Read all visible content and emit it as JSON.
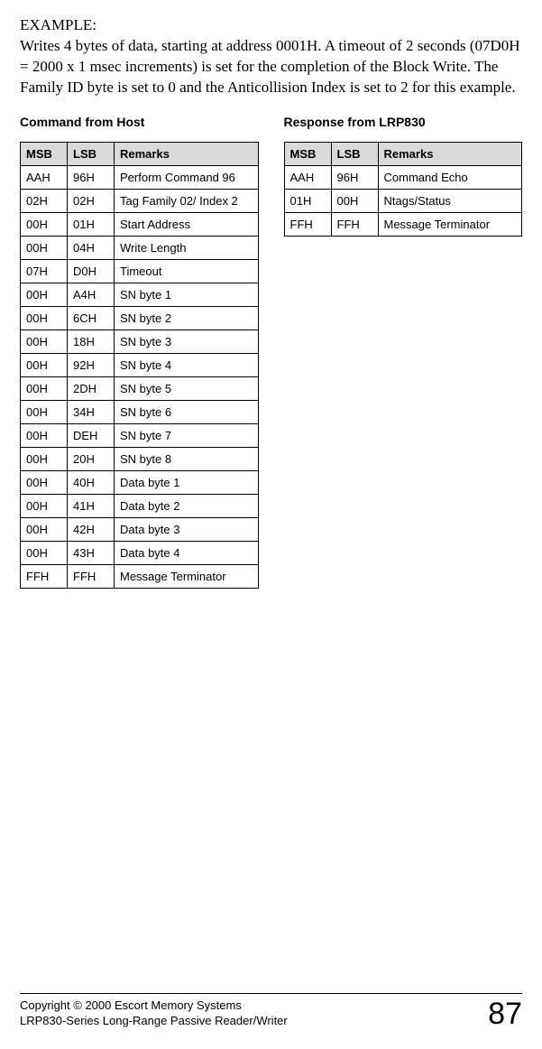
{
  "example": {
    "label": "EXAMPLE:",
    "paragraph": "Writes 4 bytes of data, starting at address 0001H. A timeout of 2 seconds (07D0H = 2000 x 1 msec increments) is set for the completion of the Block Write.  The Family ID byte is set to 0 and the Anticollision Index is set to 2 for this example."
  },
  "left": {
    "title": "Command from Host",
    "headers": {
      "msb": "MSB",
      "lsb": "LSB",
      "remarks": "Remarks"
    },
    "rows": [
      {
        "msb": "AAH",
        "lsb": "96H",
        "remarks": "Perform Command 96"
      },
      {
        "msb": "02H",
        "lsb": "02H",
        "remarks": "Tag Family 02/ Index 2"
      },
      {
        "msb": "00H",
        "lsb": "01H",
        "remarks": "Start Address"
      },
      {
        "msb": "00H",
        "lsb": "04H",
        "remarks": "Write Length"
      },
      {
        "msb": "07H",
        "lsb": "D0H",
        "remarks": "Timeout"
      },
      {
        "msb": "00H",
        "lsb": "A4H",
        "remarks": "SN byte 1"
      },
      {
        "msb": "00H",
        "lsb": "6CH",
        "remarks": "SN byte 2"
      },
      {
        "msb": "00H",
        "lsb": "18H",
        "remarks": "SN byte 3"
      },
      {
        "msb": "00H",
        "lsb": "92H",
        "remarks": "SN byte 4"
      },
      {
        "msb": "00H",
        "lsb": "2DH",
        "remarks": "SN byte 5"
      },
      {
        "msb": "00H",
        "lsb": "34H",
        "remarks": "SN byte 6"
      },
      {
        "msb": "00H",
        "lsb": "DEH",
        "remarks": "SN byte 7"
      },
      {
        "msb": "00H",
        "lsb": "20H",
        "remarks": "SN byte 8"
      },
      {
        "msb": "00H",
        "lsb": "40H",
        "remarks": "Data byte 1"
      },
      {
        "msb": "00H",
        "lsb": "41H",
        "remarks": "Data byte 2"
      },
      {
        "msb": "00H",
        "lsb": "42H",
        "remarks": "Data byte 3"
      },
      {
        "msb": "00H",
        "lsb": "43H",
        "remarks": "Data byte 4"
      },
      {
        "msb": "FFH",
        "lsb": "FFH",
        "remarks": "Message Terminator"
      }
    ]
  },
  "right": {
    "title": "Response from LRP830",
    "headers": {
      "msb": "MSB",
      "lsb": "LSB",
      "remarks": "Remarks"
    },
    "rows": [
      {
        "msb": "AAH",
        "lsb": "96H",
        "remarks": "Command Echo"
      },
      {
        "msb": "01H",
        "lsb": "00H",
        "remarks": "Ntags/Status"
      },
      {
        "msb": "FFH",
        "lsb": "FFH",
        "remarks": "Message Terminator"
      }
    ]
  },
  "footer": {
    "line1": "Copyright © 2000 Escort Memory Systems",
    "line2": "LRP830-Series Long-Range Passive Reader/Writer",
    "page": "87"
  }
}
